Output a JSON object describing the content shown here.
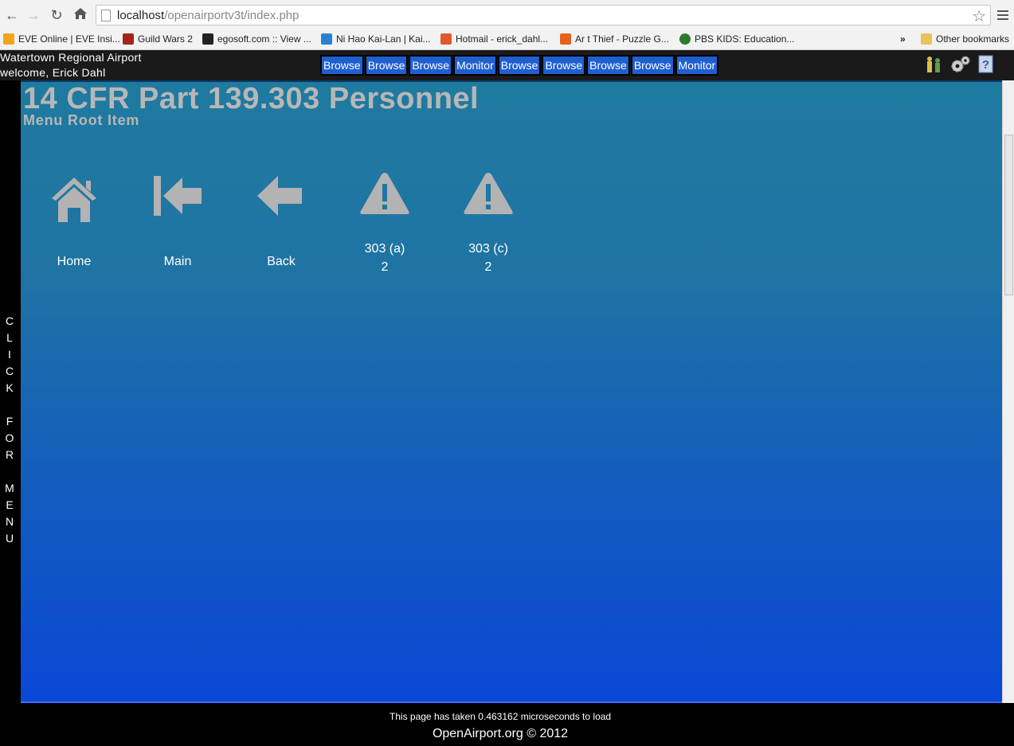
{
  "browser": {
    "url_host": "localhost",
    "url_path": "/openairportv3t/index.php"
  },
  "bookmarks": [
    {
      "label": "EVE Online | EVE Insi...",
      "color": "#f3a21b"
    },
    {
      "label": "Guild Wars 2",
      "color": "#a5241a"
    },
    {
      "label": "egosoft.com :: View ...",
      "color": "#222222"
    },
    {
      "label": "Ni Hao Kai-Lan | Kai...",
      "color": "#2a7fd4"
    },
    {
      "label": "Hotmail - erick_dahl...",
      "color": "#e3572d"
    },
    {
      "label": "Ar t Thief - Puzzle G...",
      "color": "#e8611a"
    },
    {
      "label": "PBS KIDS: Education...",
      "color": "#2d7a2d"
    }
  ],
  "bookmarks_overflow": "»",
  "other_bookmarks": "Other bookmarks",
  "header": {
    "airport_name": "Watertown Regional Airport",
    "welcome": "welcome, Erick Dahl"
  },
  "nav_tabs": [
    "Browse",
    "Browse",
    "Browse",
    "Monitor",
    "Browse",
    "Browse",
    "Browse",
    "Browse",
    "Monitor"
  ],
  "side_menu_text": "C\nL\nI\nC\nK\n\nF\nO\nR\n\nM\nE\nN\nU",
  "page": {
    "title": "14 CFR Part 139.303 Personnel",
    "subtitle": "Menu Root Item"
  },
  "tiles": [
    {
      "icon": "home-icon",
      "label": "Home",
      "sub": ""
    },
    {
      "icon": "first-page-icon",
      "label": "Main",
      "sub": ""
    },
    {
      "icon": "back-arrow-icon",
      "label": "Back",
      "sub": ""
    },
    {
      "icon": "warning-icon",
      "label": "303 (a)",
      "sub": "2"
    },
    {
      "icon": "warning-icon",
      "label": "303 (c)",
      "sub": "2"
    }
  ],
  "footer": {
    "load_time": "This page has taken 0.463162 microseconds to load",
    "copyright": "OpenAirport.org © 2012"
  },
  "colors": {
    "tab_bg": "#1f5fd0",
    "icon_gray": "#b3b3b3",
    "title_gray": "#b7b7b7"
  }
}
